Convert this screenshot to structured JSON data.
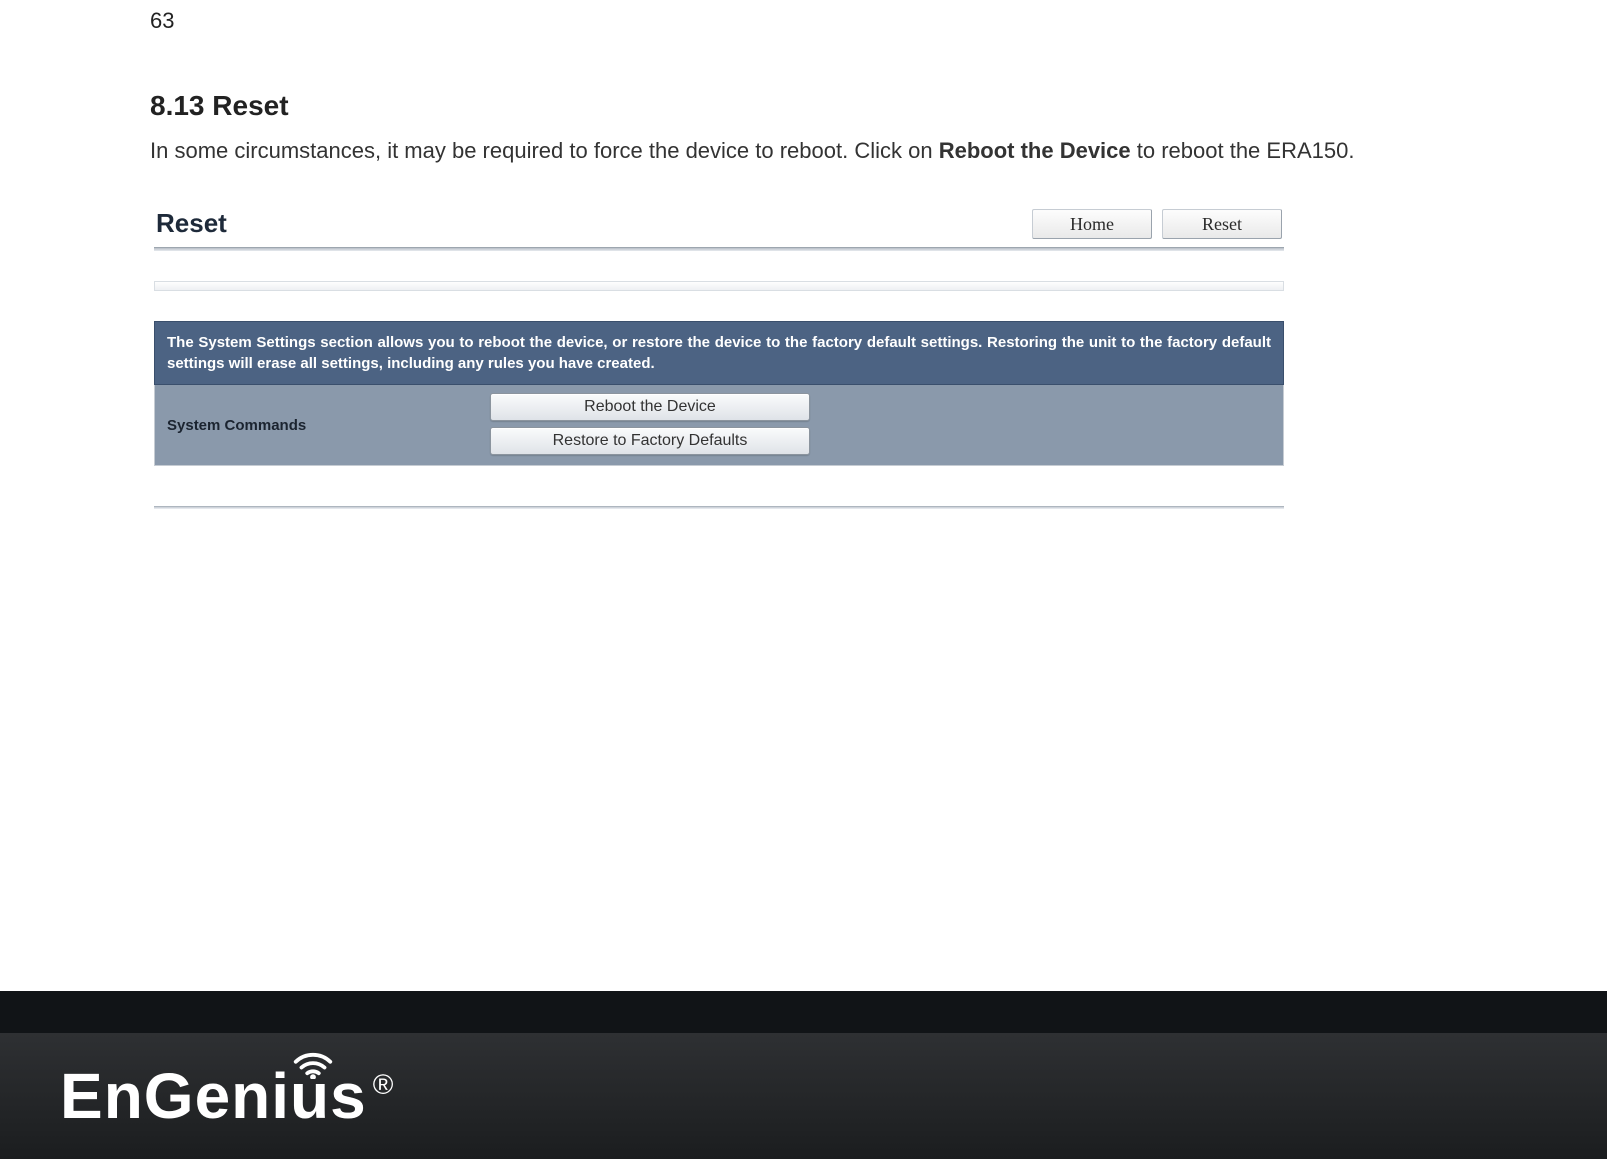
{
  "page_number": "63",
  "section": {
    "heading": "8.13 Reset",
    "intro_pre": "In some circumstances, it may be required to force the device to reboot. Click on ",
    "intro_bold": "Reboot the Device",
    "intro_post": " to reboot the ERA150."
  },
  "ui": {
    "title": "Reset",
    "nav": {
      "home": "Home",
      "reset": "Reset"
    },
    "info_banner": "The System Settings section allows you to reboot the device, or restore the device to the factory default settings. Restoring the unit to the factory default settings will erase all settings, including any rules you have created.",
    "commands_label": "System Commands",
    "buttons": {
      "reboot": "Reboot the Device",
      "restore": "Restore to Factory Defaults"
    }
  },
  "brand": {
    "name": "EnGenius",
    "registered": "®"
  }
}
